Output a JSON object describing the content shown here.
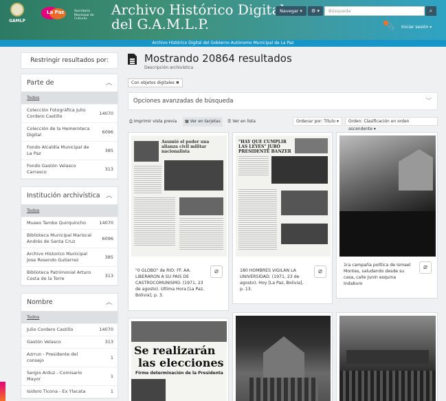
{
  "header": {
    "logo1_text": "GAMLP",
    "logo2_text": "La Paz",
    "logo3_lines": [
      "Secretaría Municipal de",
      "Culturas"
    ],
    "site_title_1": "Archivo Histórico Digital",
    "site_title_2": "del G.A.M.L.P.",
    "nav_label": "Navegar ▾",
    "gear_label": "⚙ ▾",
    "search_placeholder": "Búsqueda",
    "login_label": "Iniciar sesión ▾",
    "subtitle": "Archivo Histórico Digital del Gobierno Autónomo Municipal de La Paz"
  },
  "sidebar": {
    "restrict_label": "Restringir resultados por:",
    "facets": [
      {
        "title": "Parte de",
        "todos": "Todos",
        "items": [
          {
            "label": "Colección Fotográfica Julio Cordero Castillo",
            "count": "14070"
          },
          {
            "label": "Colección de la Hemeroteca Digital",
            "count": "6096"
          },
          {
            "label": "Fondo Alcaldía Municipal de La Paz",
            "count": "385"
          },
          {
            "label": "Fondo Gastón Velasco Carrasco",
            "count": "313"
          }
        ]
      },
      {
        "title": "Institución archivística",
        "todos": "Todos",
        "items": [
          {
            "label": "Museo Tambo Quirquincho",
            "count": "14070"
          },
          {
            "label": "Biblioteca Municipal Mariscal Andrés de Santa Cruz",
            "count": "6096"
          },
          {
            "label": "Archivo Historico Municipal Jose Rosendo Gutierrez",
            "count": "385"
          },
          {
            "label": "Biblioteca Patrimonial Arturo Costa de la Torre",
            "count": "313"
          }
        ]
      },
      {
        "title": "Nombre",
        "todos": "Todos",
        "items": [
          {
            "label": "Julio Cordero Castillo",
            "count": "14070"
          },
          {
            "label": "Gastón Velasco",
            "count": "313"
          },
          {
            "label": "Azrrun - Presidente del consejo",
            "count": "1"
          },
          {
            "label": "Sergio Arduz - Comisario Mayor",
            "count": "1"
          },
          {
            "label": "Isidoro Ticona - Ex Ylacata",
            "count": "1"
          }
        ]
      }
    ]
  },
  "main": {
    "title": "Mostrando 20864 resultados",
    "subtitle": "Descripción archivística",
    "chip": "Con objetos digitales ✖",
    "advanced": "Opciones avanzadas de búsqueda",
    "print": "Imprimir vista previa",
    "cards_view": "Ver en tarjetas",
    "list_view": "Ver en lista",
    "sort": "Ordenar por: Título ▾",
    "order": "Orden: Clasificación en orden ascendente ▾",
    "cards": [
      {
        "caption": "\"0 GLOBO\" de RIO: FF. AA. LIBERARON A SU PAIS DE CASTROCOMUNISMO. (1971, 23 de agosto). Ultima Hora [La Paz, Bolivia], p. 3."
      },
      {
        "caption": "180 HOMBRES VIGILAN LA UNIVERSIDAD. (1971, 23 de agosto). Hoy [La Paz, Bolivia], p. 13."
      },
      {
        "caption": "1ra campaña política de Ismael Montes, saludando desde su casa, calle Junín esquina Indaburo"
      }
    ],
    "newspaper_headline_1": "Se realizarán",
    "newspaper_headline_2": "las elecciones",
    "newspaper_sub": "Firme determinación de la Presidenta",
    "news1_head": "Asumió el poder una alianza civil militar nacionalista",
    "news2_head": "\"HAY QUE CUMPLIR LAS LEYES\" JURÓ PRESIDENTE BANZER"
  }
}
